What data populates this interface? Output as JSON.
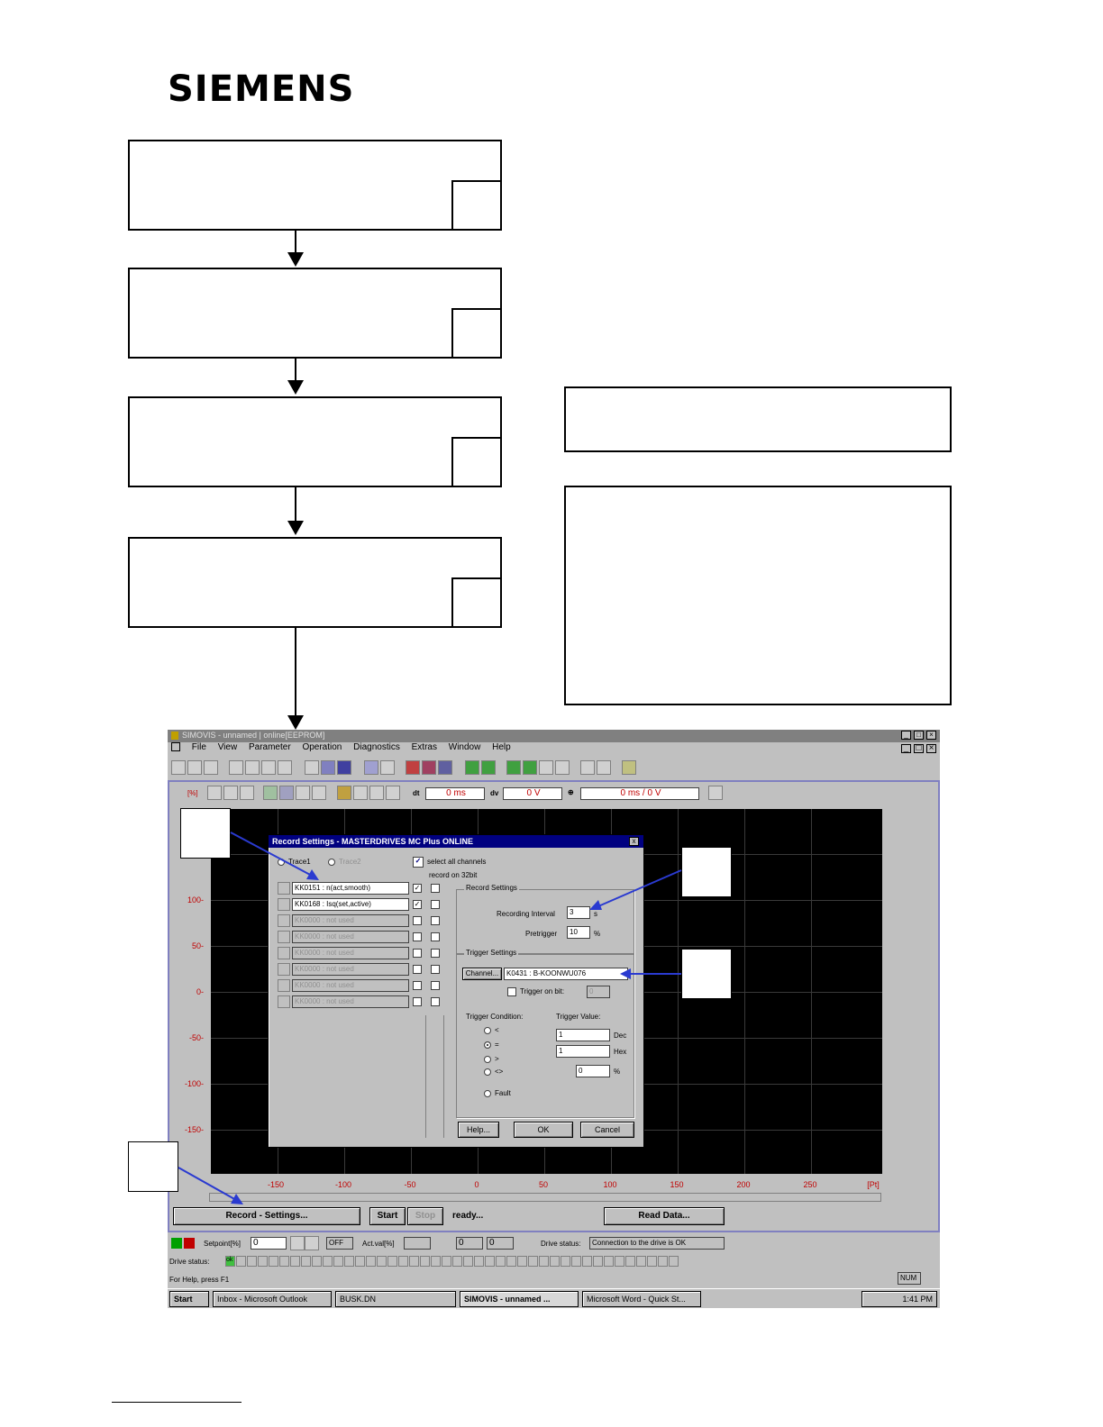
{
  "header": {
    "logo_text": "SIEMENS"
  },
  "app": {
    "title": "SIMOVIS - unnamed | online[EEPROM]",
    "menu": [
      "File",
      "View",
      "Parameter",
      "Operation",
      "Diagnostics",
      "Extras",
      "Window",
      "Help"
    ],
    "toolbar2": {
      "unit_label": "[%]",
      "dt_label": "dt",
      "dt_value": "0 ms",
      "dv_label": "dv",
      "dv_value": "0 V",
      "cursor_value": "0 ms / 0 V"
    },
    "plot": {
      "y_ticks": [
        "100-",
        "50-",
        "0-",
        "-50-",
        "-100-",
        "-150-"
      ],
      "x_ticks": [
        "-150",
        "-100",
        "-50",
        "0",
        "50",
        "100",
        "150",
        "200",
        "250"
      ],
      "x_unit": "[Pt]"
    },
    "bottom_buttons": {
      "record_settings": "Record - Settings...",
      "start": "Start",
      "stop": "Stop",
      "status": "ready...",
      "read_data": "Read Data..."
    },
    "status_bar": {
      "setpoint_label": "Setpoint[%]",
      "setpoint_value": "0",
      "off_label": "OFF",
      "act_val_label": "Act.val[%]",
      "act_val_1": "0",
      "act_val_2": "0",
      "drive_status_label": "Drive status:",
      "drive_status_value": "Connection to the drive is OK",
      "drive_status_label2": "Drive status:",
      "ok_label": "ok",
      "help_text": "For Help, press F1",
      "num": "NUM"
    },
    "taskbar": {
      "start": "Start",
      "items": [
        "Inbox - Microsoft Outlook",
        "BUSK.DN",
        "SIMOVIS - unnamed ...",
        "Microsoft Word - Quick St..."
      ],
      "time": "1:41 PM"
    }
  },
  "dialog": {
    "title": "Record Settings - MASTERDRIVES MC Plus ONLINE",
    "close": "x",
    "trace1": "Trace1",
    "trace2": "Trace2",
    "select_all": "select all channels",
    "record_32bit": "record on 32bit",
    "channels": [
      "KK0151 : n(act,smooth)",
      "KK0168 : Isq(set,active)",
      "KK0000 : not used",
      "KK0000 : not used",
      "KK0000 : not used",
      "KK0000 : not used",
      "KK0000 : not used",
      "KK0000 : not used"
    ],
    "record_settings_group": "Record Settings",
    "recording_interval_label": "Recording Interval",
    "recording_interval_value": "3",
    "recording_interval_unit": "s",
    "pretrigger_label": "Pretrigger",
    "pretrigger_value": "10",
    "pretrigger_unit": "%",
    "trigger_settings_group": "Trigger Settings",
    "channel_button": "Channel...",
    "trigger_channel_value": "K0431 : B-KOONWU076",
    "trigger_on_bit": "Trigger on bit:",
    "trigger_bit_value": "0",
    "trigger_condition_label": "Trigger Condition:",
    "trigger_value_label": "Trigger Value:",
    "conditions": [
      "<",
      "=",
      ">",
      "<>",
      "Fault"
    ],
    "dec_value": "1",
    "dec_label": "Dec",
    "hex_value": "1",
    "hex_label": "Hex",
    "pct_value": "0",
    "pct_label": "%",
    "help_button": "Help...",
    "ok_button": "OK",
    "cancel_button": "Cancel"
  }
}
